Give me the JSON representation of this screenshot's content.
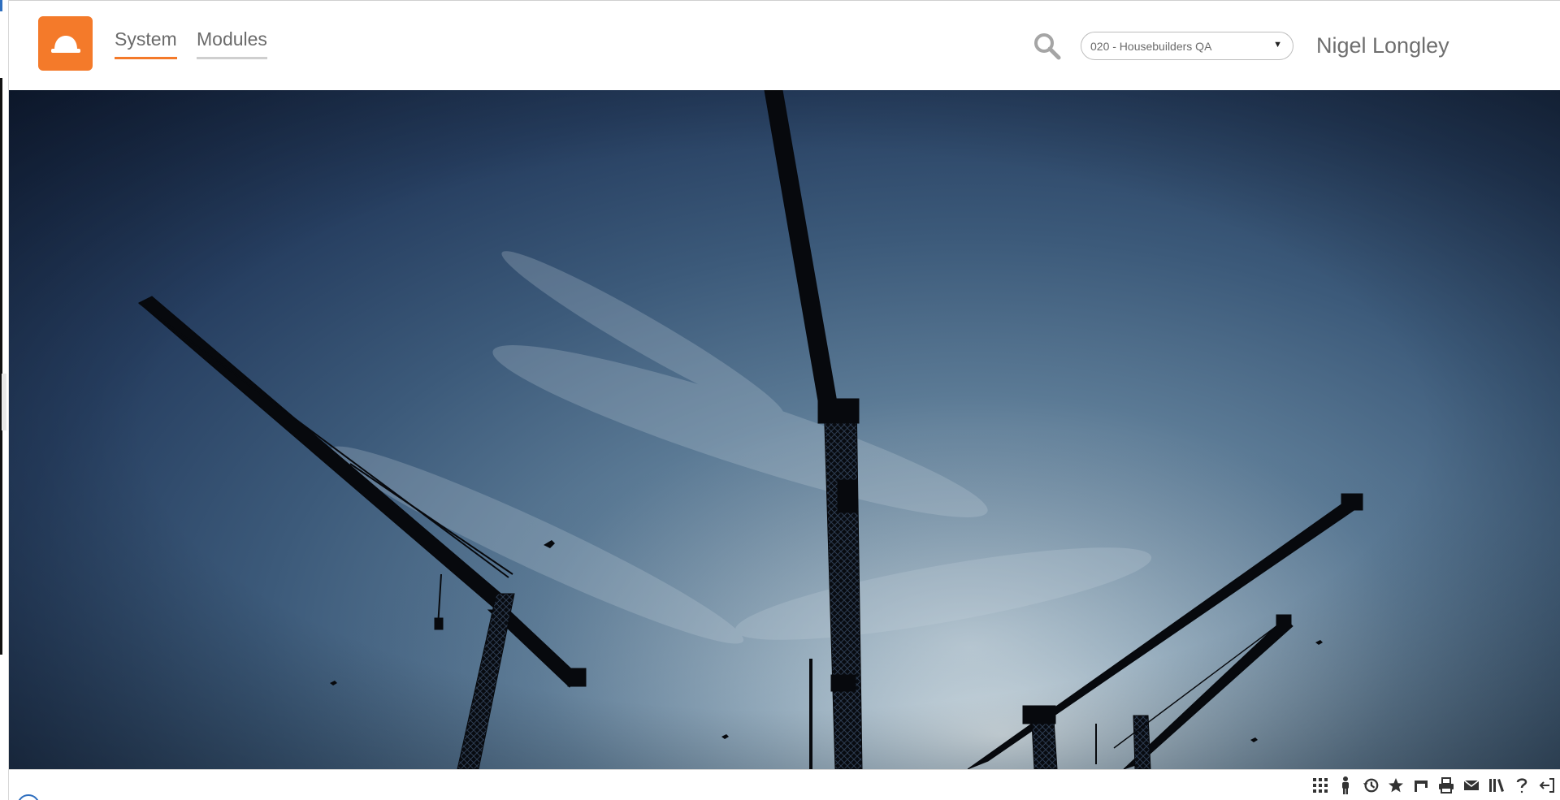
{
  "header": {
    "logo_icon": "hard-hat-icon",
    "brand_color": "#f47a2a",
    "nav": [
      {
        "label": "System",
        "active": true
      },
      {
        "label": "Modules",
        "active": false
      }
    ],
    "search_icon": "search-icon",
    "organisation_select": {
      "value": "020 - Housebuilders QA"
    },
    "user_name": "Nigel Longley"
  },
  "hero": {
    "subject": "construction-cranes-at-dusk-image"
  },
  "toolbar": {
    "icons": [
      "grid-icon",
      "person-icon",
      "history-icon",
      "star-icon",
      "flag-icon",
      "printer-icon",
      "mail-icon",
      "library-icon",
      "help-icon",
      "logout-icon"
    ]
  }
}
